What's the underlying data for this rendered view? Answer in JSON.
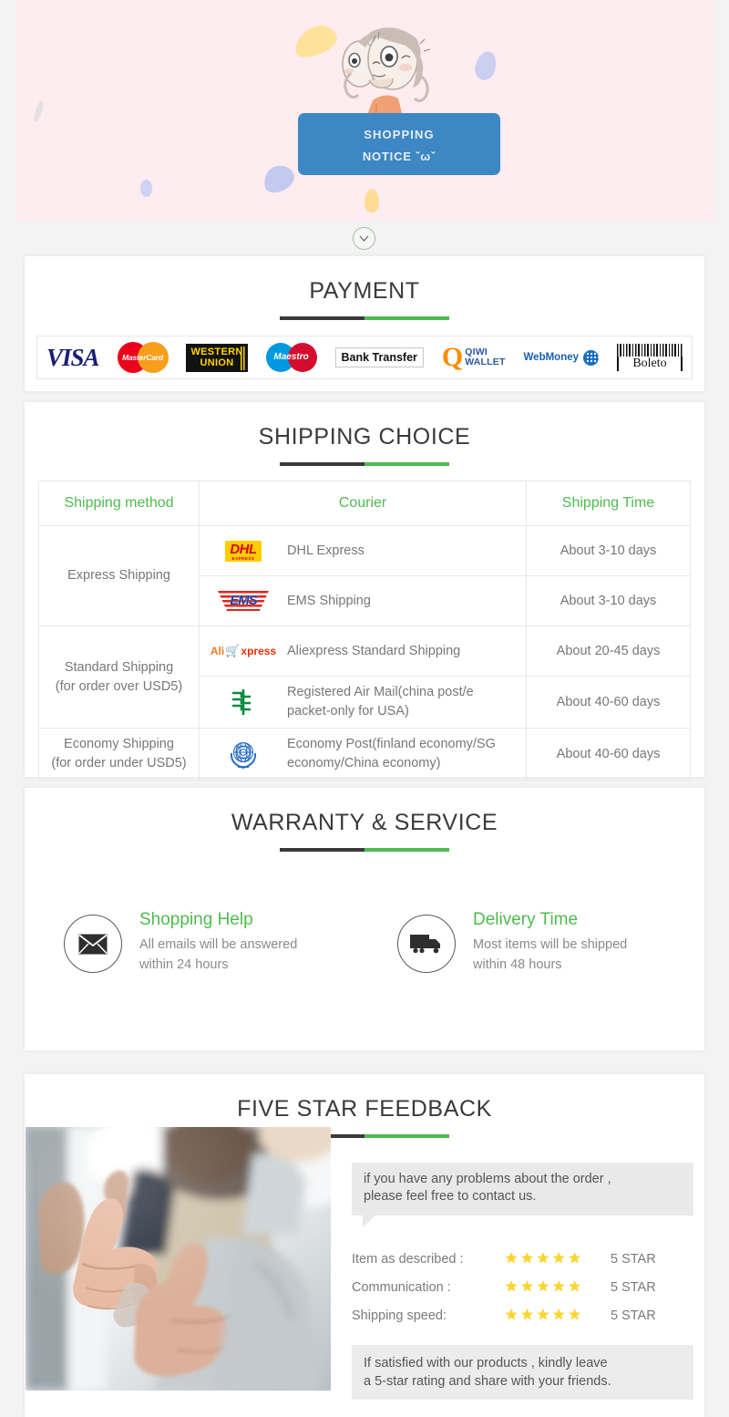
{
  "hero": {
    "button_line1": "SHOPPING",
    "button_line2": "NOTICE ˇωˇ",
    "button_color": "#3c87c4",
    "background_color": "#fdecf0",
    "scroll_icon": "chevron-down-icon"
  },
  "payment": {
    "title": "PAYMENT",
    "methods": [
      {
        "name": "VISA",
        "icon": "visa-logo"
      },
      {
        "name": "MasterCard",
        "icon": "mastercard-logo"
      },
      {
        "name": "WESTERN UNION",
        "line1": "WESTERN",
        "line2": "UNION",
        "icon": "western-union-logo"
      },
      {
        "name": "Maestro",
        "icon": "maestro-logo"
      },
      {
        "name": "Bank Transfer",
        "icon": "bank-transfer-logo"
      },
      {
        "name": "QIWI WALLET",
        "line1": "QIWI",
        "line2": "WALLET",
        "icon": "qiwi-wallet-logo"
      },
      {
        "name": "WebMoney",
        "icon": "webmoney-logo"
      },
      {
        "name": "Boleto",
        "icon": "boleto-logo"
      }
    ]
  },
  "shipping": {
    "title": "SHIPPING CHOICE",
    "headers": [
      "Shipping method",
      "Courier",
      "Shipping Time"
    ],
    "groups": [
      {
        "method": "Express Shipping",
        "rows": [
          {
            "logo": "dhl-logo",
            "courier": "DHL Express",
            "time": "About 3-10 days"
          },
          {
            "logo": "ems-logo",
            "courier": "EMS Shipping",
            "time": "About 3-10 days"
          }
        ]
      },
      {
        "method": "Standard Shipping\n(for order over USD5)",
        "method_line1": "Standard Shipping",
        "method_line2": "(for order over USD5)",
        "rows": [
          {
            "logo": "aliexpress-logo",
            "courier": "Aliexpress Standard Shipping",
            "time": "About 20-45 days"
          },
          {
            "logo": "china-post-logo",
            "courier": "Registered Air Mail(china post/e packet-only for USA)",
            "time": "About 40-60 days"
          }
        ]
      },
      {
        "method": "Economy Shipping\n(for order under USD5)",
        "method_line1": "Economy Shipping",
        "method_line2": "(for order under USD5)",
        "rows": [
          {
            "logo": "un-post-logo",
            "courier": "Economy Post(finland economy/SG economy/China economy)",
            "time": "About 40-60 days"
          }
        ]
      }
    ]
  },
  "warranty": {
    "title": "WARRANTY & SERVICE",
    "services": [
      {
        "icon": "envelope-icon",
        "title": "Shopping Help",
        "desc_line1": "All emails will be answered",
        "desc_line2": "within 24 hours"
      },
      {
        "icon": "truck-icon",
        "title": "Delivery Time",
        "desc_line1": "Most items will be shipped",
        "desc_line2": "within 48 hours"
      }
    ]
  },
  "feedback": {
    "title": "FIVE STAR FEEDBACK",
    "photo_alt": "thumbs-up-photo",
    "bubble_line1": "if you have any problems about the order ,",
    "bubble_line2": "please feel free to contact us.",
    "ratings": [
      {
        "label": "Item as described :",
        "stars": 5,
        "value": "5 STAR"
      },
      {
        "label": "Communication :",
        "stars": 5,
        "value": "5 STAR"
      },
      {
        "label": "Shipping speed:",
        "stars": 5,
        "value": "5 STAR"
      }
    ],
    "note_line1": "If satisfied with our products ,  kindly leave",
    "note_line2": "a 5-star rating and share with your friends."
  },
  "theme": {
    "green": "#4fbb4f",
    "dark": "#3a3a3a",
    "text_gray": "#777777"
  }
}
